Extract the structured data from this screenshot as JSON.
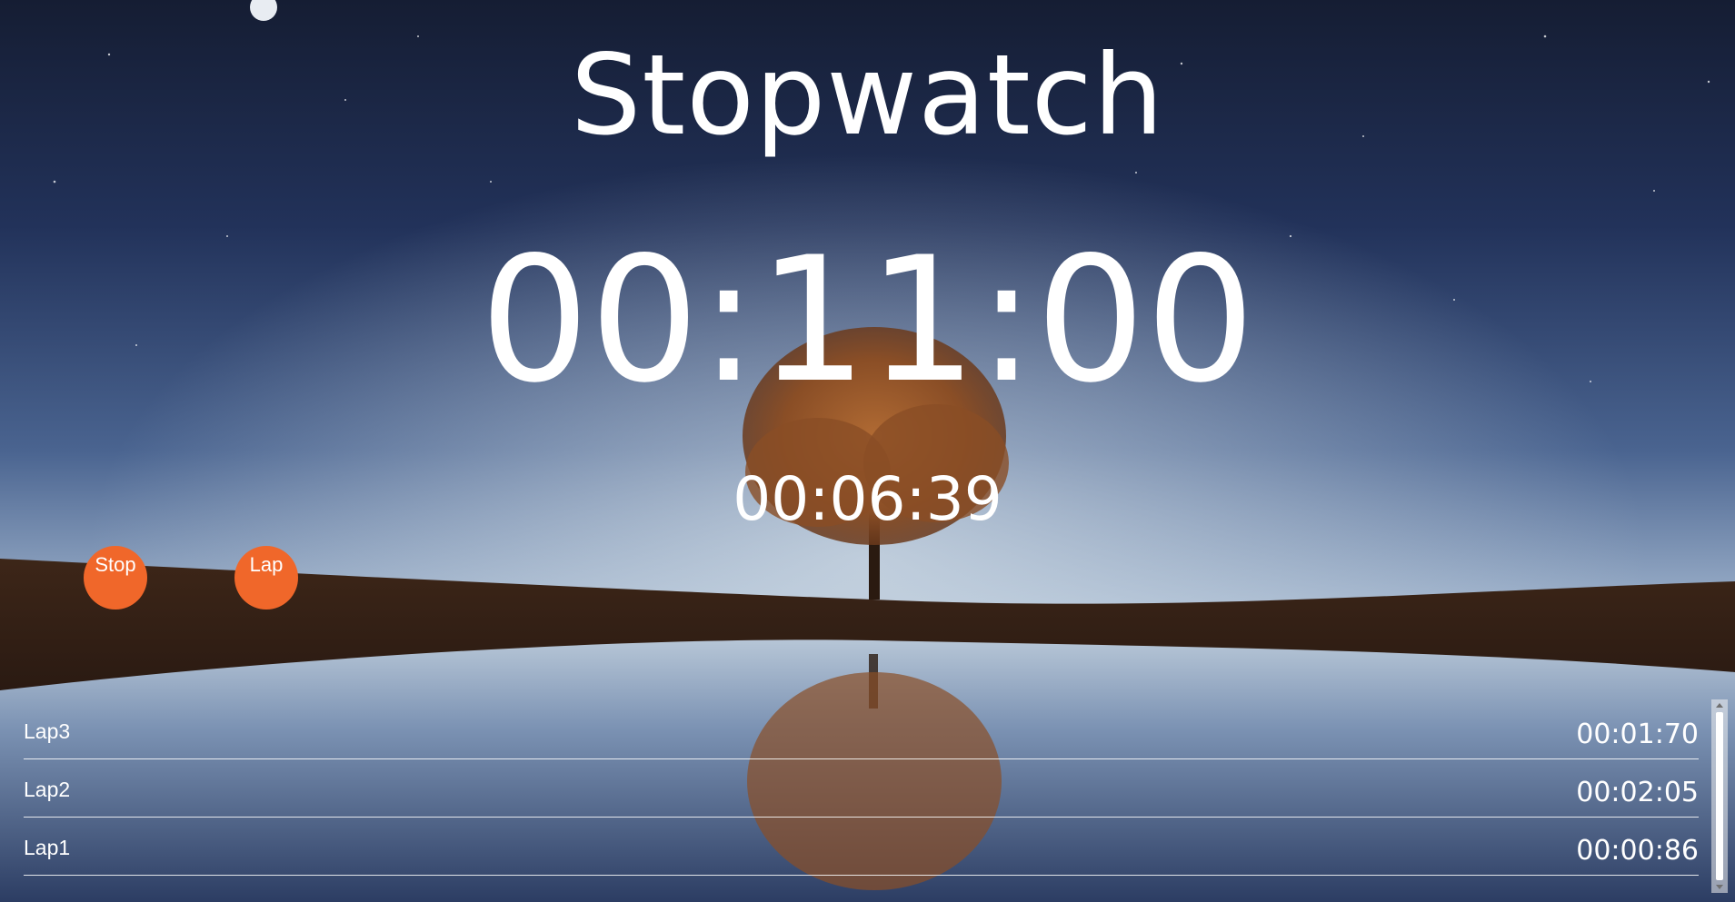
{
  "app": {
    "title": "Stopwatch"
  },
  "timer": {
    "main": "00:11:00",
    "lap": "00:06:39"
  },
  "controls": {
    "stop_label": "Stop",
    "lap_label": "Lap"
  },
  "laps": [
    {
      "name": "Lap3",
      "time": "00:01:70"
    },
    {
      "name": "Lap2",
      "time": "00:02:05"
    },
    {
      "name": "Lap1",
      "time": "00:00:86"
    }
  ],
  "background": {
    "description_icon": "night-lake-tree-image"
  },
  "colors": {
    "accent": "#f0672a",
    "text": "#ffffff"
  }
}
